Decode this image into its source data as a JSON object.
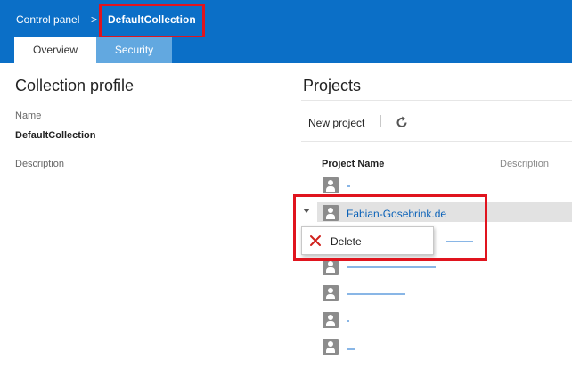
{
  "header": {
    "breadcrumb_root": "Control panel",
    "breadcrumb_sep": ">",
    "breadcrumb_current": "DefaultCollection",
    "background_color": "#0b6fc7"
  },
  "tabs": [
    {
      "label": "Overview",
      "active": true
    },
    {
      "label": "Security",
      "active": false
    }
  ],
  "profile": {
    "title": "Collection profile",
    "name_label": "Name",
    "name_value": "DefaultCollection",
    "description_label": "Description"
  },
  "projects": {
    "title": "Projects",
    "new_project_label": "New project",
    "refresh_icon": "refresh-icon",
    "columns": {
      "name": "Project Name",
      "description": "Description"
    },
    "selected_project": "Fabian-Gosebrink.de",
    "context_menu": {
      "delete_label": "Delete",
      "delete_icon": "close-x-icon"
    }
  },
  "colors": {
    "accent": "#0b6fc7",
    "tab_inactive": "#62a8e0",
    "highlight_box": "#e0141e",
    "link": "#0b62b8",
    "selected_row": "#e2e2e2"
  }
}
